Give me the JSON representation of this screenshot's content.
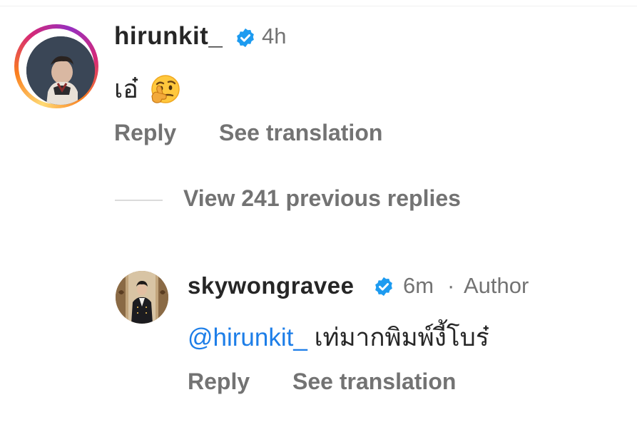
{
  "main_comment": {
    "username": "hirunkit_",
    "time": "4h",
    "text": "เอ๋",
    "emoji_icon": "thinking-face-emoji",
    "reply_label": "Reply",
    "translate_label": "See translation",
    "story_ring_colors": [
      "#feda75",
      "#fa7e1e",
      "#d62976",
      "#962fbf"
    ]
  },
  "view_replies": {
    "label": "View 241 previous replies"
  },
  "reply_comment": {
    "username": "skywongravee",
    "time": "6m",
    "separator": "·",
    "author_label": "Author",
    "mention": "@hirunkit_",
    "text": "เท่มากพิมพ์งี้โบร๋",
    "reply_label": "Reply",
    "translate_label": "See translation"
  },
  "colors": {
    "verified_badge": "#1d9bf0",
    "mention": "#1d7ee8",
    "secondary_text": "#737373",
    "primary_text": "#262626"
  }
}
